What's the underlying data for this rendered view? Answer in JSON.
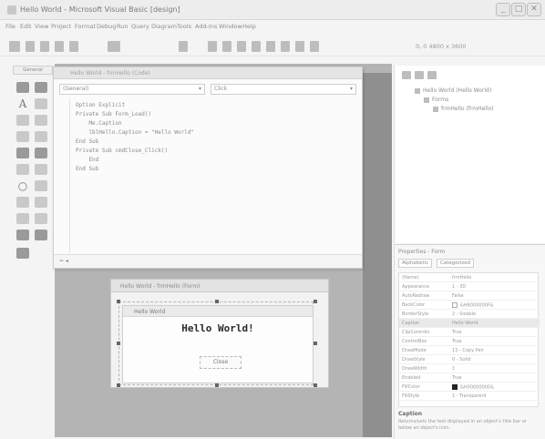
{
  "window": {
    "title": "Hello World - Microsoft Visual Basic [design]",
    "minimize": "_",
    "restore": "□",
    "close": "✕"
  },
  "menu": [
    "File",
    "Edit",
    "View",
    "Project",
    "Format",
    "Debug",
    "Run",
    "Query",
    "Diagram",
    "Tools",
    "Add-Ins",
    "Window",
    "Help"
  ],
  "toolbar": {
    "location": "0, 0  4800 x 3600"
  },
  "toolbox": {
    "header": "General",
    "tools": [
      "pointer-icon",
      "picture-icon",
      "label-icon",
      "textbox-icon",
      "frame-icon",
      "commandbutton-icon",
      "checkbox-icon",
      "optionbutton-icon",
      "combobox-icon",
      "listbox-icon",
      "hscroll-icon",
      "vscroll-icon",
      "timer-icon",
      "drivelist-icon",
      "shape-icon",
      "line-icon",
      "image-icon",
      "data-icon",
      "ole-icon"
    ]
  },
  "code_window": {
    "title": "Hello World - frmHello (Code)",
    "object_dropdown": "(General)",
    "procedure_dropdown": "Click",
    "lines": [
      "Option Explicit",
      "Private Sub Form_Load()",
      "    Me.Caption",
      "    lblHello.Caption = \"Hello World\"",
      "End Sub",
      "Private Sub cmdClose_Click()",
      "    End",
      "End Sub"
    ],
    "zoom": "=  ◂"
  },
  "form_window": {
    "title": "Hello World - frmHello (Form)",
    "inner_title": "Hello World",
    "label_text": "Hello World!",
    "button_text": "Close"
  },
  "solution_explorer": {
    "root": "Hello World (Hello World)",
    "folder": "Forms",
    "item": "frmHello (frmHello)"
  },
  "properties": {
    "header": "Properties - Form",
    "tab_alpha": "Alphabetic",
    "tab_category": "Categorized",
    "rows": [
      {
        "name": "(Name)",
        "value": "frmHello"
      },
      {
        "name": "Appearance",
        "value": "1 - 3D"
      },
      {
        "name": "AutoRedraw",
        "value": "False"
      },
      {
        "name": "BackColor",
        "value": "&H8000000F&"
      },
      {
        "name": "BorderStyle",
        "value": "2 - Sizable"
      },
      {
        "name": "Caption",
        "value": "Hello World"
      },
      {
        "name": "ClipControls",
        "value": "True"
      },
      {
        "name": "ControlBox",
        "value": "True"
      },
      {
        "name": "DrawMode",
        "value": "13 - Copy Pen"
      },
      {
        "name": "DrawStyle",
        "value": "0 - Solid"
      },
      {
        "name": "DrawWidth",
        "value": "1"
      },
      {
        "name": "Enabled",
        "value": "True"
      },
      {
        "name": "FillColor",
        "value": "&H00000000&"
      },
      {
        "name": "FillStyle",
        "value": "1 - Transparent"
      }
    ],
    "desc_title": "Caption",
    "desc_text": "Returns/sets the text displayed in an object's title bar or below an object's icon."
  },
  "colors": {
    "canvas": "#b4b4b4",
    "canvas_edge": "#8f8f8f",
    "label_text": "#2a2a2a"
  }
}
